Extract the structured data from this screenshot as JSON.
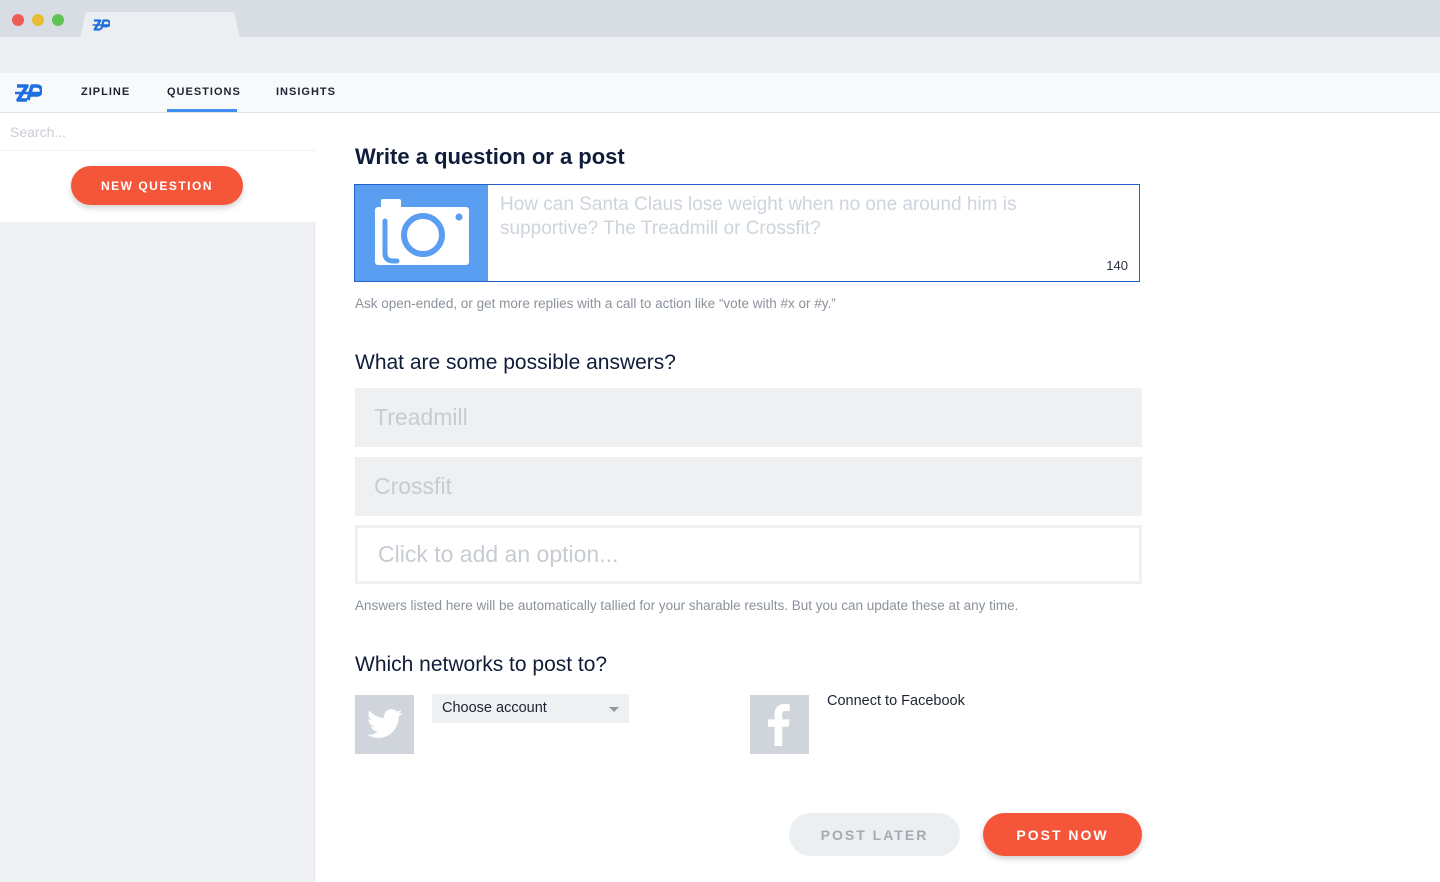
{
  "nav": {
    "items": [
      {
        "label": "ZIPLINE"
      },
      {
        "label": "QUESTIONS"
      },
      {
        "label": "INSIGHTS"
      }
    ],
    "active": "QUESTIONS"
  },
  "sidebar": {
    "search_placeholder": "Search...",
    "new_question_label": "NEW QUESTION"
  },
  "compose": {
    "heading": "Write a question or a post",
    "placeholder": "How can Santa Claus lose weight when no one around him is supportive? The Treadmill or Crossfit?",
    "char_count": "140",
    "hint": "Ask open-ended, or get more replies with a call to action like “vote with #x or #y.”"
  },
  "answers": {
    "heading": "What are some possible answers?",
    "options": [
      "Treadmill",
      "Crossfit"
    ],
    "add_placeholder": "Click to add an option...",
    "hint": "Answers listed here will be automatically tallied for your sharable results. But you can update these at any time."
  },
  "networks": {
    "heading": "Which networks to post to?",
    "twitter_select": "Choose account",
    "facebook_link": "Connect to Facebook"
  },
  "actions": {
    "post_later": "POST LATER",
    "post_now": "POST NOW"
  },
  "colors": {
    "accent": "#f5563a",
    "primary_blue": "#2461c9",
    "nav_underline": "#3d8ef0",
    "heading": "#0f1d3a"
  },
  "icons": [
    "zipline-logo-icon",
    "camera-icon",
    "twitter-icon",
    "facebook-icon",
    "caret-down-icon"
  ]
}
